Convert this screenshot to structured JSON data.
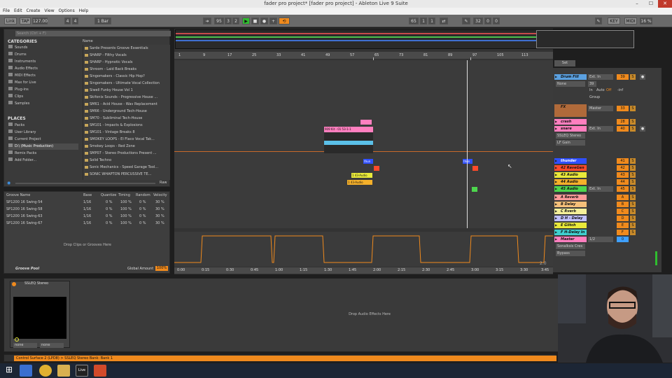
{
  "window": {
    "title": "fader pro project*  [fader pro project]  - Ableton Live 9 Suite",
    "min": "–",
    "max": "☐",
    "close": "✕"
  },
  "menu": [
    "File",
    "Edit",
    "Create",
    "View",
    "Options",
    "Help"
  ],
  "transport": {
    "link": "Link",
    "tap": "TAP",
    "tempo": "127.00",
    "sig_num": "4",
    "sig_den": "4",
    "quant": "1 Bar",
    "pos": [
      "95",
      "3",
      "2"
    ],
    "loop_start": [
      "65",
      "1",
      "1"
    ],
    "loop_len": [
      "32",
      "0",
      "0"
    ],
    "key": "KEY",
    "midi": "MIDI",
    "cpu": "16 %"
  },
  "browser": {
    "search_placeholder": "Search (Ctrl + F)",
    "categories_title": "CATEGORIES",
    "categories": [
      "Sounds",
      "Drums",
      "Instruments",
      "Audio Effects",
      "MIDI Effects",
      "Max for Live",
      "Plug-ins",
      "Clips",
      "Samples"
    ],
    "places_title": "PLACES",
    "places": [
      "Packs",
      "User Library",
      "Current Project",
      "D:\\ (Music Production)",
      "Remix Packs",
      "Add Folder..."
    ],
    "name_header": "Name",
    "raw": "Raw",
    "files": [
      "Sarde Presents Groove Essentials",
      "SHARP - Filthy Vocals",
      "SHARP - Hypnotic Vocals",
      "Shroom - Laid Back Breaks",
      "Singomakers - Classic Hip Hop?",
      "Singomakers - Ultimate Vocal Collection",
      "Siwell Funky House Vol 1",
      "Skifonix Sounds - Progressive House ...",
      "SM61 - Acid House - Wav Replacement",
      "SM66 - Underground Tech-House",
      "SM70 - Subliminal Tech-House",
      "SM101 - Impacts & Explosions",
      "SM101 - Vintage Breaks 8",
      "SMOKEY LOOPS - El Flaco Vocal Tak...",
      "Smokey Loops - Red Zone",
      "SMP07 - Stereo Productions Present ...",
      "Solid Techno",
      "Sonic Mechanics - Speed Garage Tool...",
      "SONIC WHAPTON PERCUSSIVE TE..."
    ]
  },
  "groove": {
    "headers": [
      "Groove Name",
      "Base",
      "Quantize",
      "Timing",
      "Random",
      "Velocity"
    ],
    "rows": [
      [
        "SP1200 16 Swing-54",
        "1/16",
        "0 %",
        "100 %",
        "0 %",
        "30 %"
      ],
      [
        "SP1200 16 Swing-58",
        "1/16",
        "0 %",
        "100 %",
        "0 %",
        "30 %"
      ],
      [
        "SP1200 16 Swing-63",
        "1/16",
        "0 %",
        "100 %",
        "0 %",
        "30 %"
      ],
      [
        "SP1200 16 Swing-67",
        "1/16",
        "0 %",
        "100 %",
        "0 %",
        "30 %"
      ]
    ],
    "drop_hint": "Drop Clips or Grooves Here",
    "pool_label": "Groove Pool",
    "global_label": "Global Amount",
    "global_value": "100%"
  },
  "ruler": [
    "1",
    "9",
    "17",
    "25",
    "33",
    "41",
    "49",
    "57",
    "65",
    "73",
    "81",
    "89",
    "97",
    "105",
    "113"
  ],
  "times": [
    "0:00",
    "0:15",
    "0:30",
    "0:45",
    "1:00",
    "1:15",
    "1:30",
    "1:45",
    "2:00",
    "2:15",
    "2:30",
    "2:45",
    "3:00",
    "3:15",
    "3:30",
    "3:45"
  ],
  "clips": {
    "drum": "909 Kit - 01  53-1-1",
    "thunder1": "thun",
    "thunder2": "thun",
    "audio43": "1 43-Audio",
    "audio44": "1 43-Audio",
    "loop": "2.0"
  },
  "mixer": {
    "set": "Set",
    "tracks": [
      {
        "name": "Drum Fill",
        "num": "39",
        "color": "#5aa0e0",
        "route": "Ext. In"
      },
      {
        "name": "FX",
        "num": "33",
        "color": "#b06a3a",
        "route": "Master"
      },
      {
        "name": "crash",
        "num": "28",
        "color": "#ff7fbf",
        "route": ""
      },
      {
        "name": "snare",
        "num": "40",
        "color": "#ff7fbf",
        "route": "Ext. In"
      },
      {
        "name": "thunder",
        "num": "41",
        "color": "#2f4fff",
        "route": ""
      },
      {
        "name": "42 RaveGen",
        "num": "42",
        "color": "#ff4a2a",
        "route": ""
      },
      {
        "name": "43 Audio",
        "num": "43",
        "color": "#e9e93a",
        "route": ""
      },
      {
        "name": "44 Audio",
        "num": "44",
        "color": "#f5b02a",
        "route": ""
      },
      {
        "name": "45 Audio",
        "num": "45",
        "color": "#4dd64d",
        "route": "Ext. In"
      },
      {
        "name": "A Reverb",
        "num": "A",
        "color": "#ff9a9a",
        "route": ""
      },
      {
        "name": "B Delay",
        "num": "B",
        "color": "#f5c07a",
        "route": ""
      },
      {
        "name": "C Rverb",
        "num": "C",
        "color": "#f5f09a",
        "route": ""
      },
      {
        "name": "D H - Delay",
        "num": "D",
        "color": "#c0c0ff",
        "route": ""
      },
      {
        "name": "E Glitch",
        "num": "E",
        "color": "#e9e93a",
        "route": ""
      },
      {
        "name": "F H-Delay In",
        "num": "F",
        "color": "#3fd0d0",
        "route": ""
      },
      {
        "name": "Master",
        "num": "0",
        "color": "#ff7fbf",
        "route": "1/2"
      }
    ],
    "sonalksis": "Sonalksis Cres",
    "bypass": "Bypass",
    "lf_gain": "LF Gain",
    "ssleq": "SSLEQ Stereo",
    "none": "None",
    "group": "Group",
    "in": "In",
    "auto": "Auto",
    "off": "Off",
    "inf": "-inf"
  },
  "device": {
    "name": "SSLEQ Stereo",
    "drop_hint": "Drop Audio Effects Here",
    "sel1": "none",
    "sel2": "none"
  },
  "status": "Control Surface 2 (LPD8) > SSLEQ Stereo Bank: Bank 1",
  "colors": {
    "accent": "#f08a1d",
    "play": "#2fbd2f"
  }
}
